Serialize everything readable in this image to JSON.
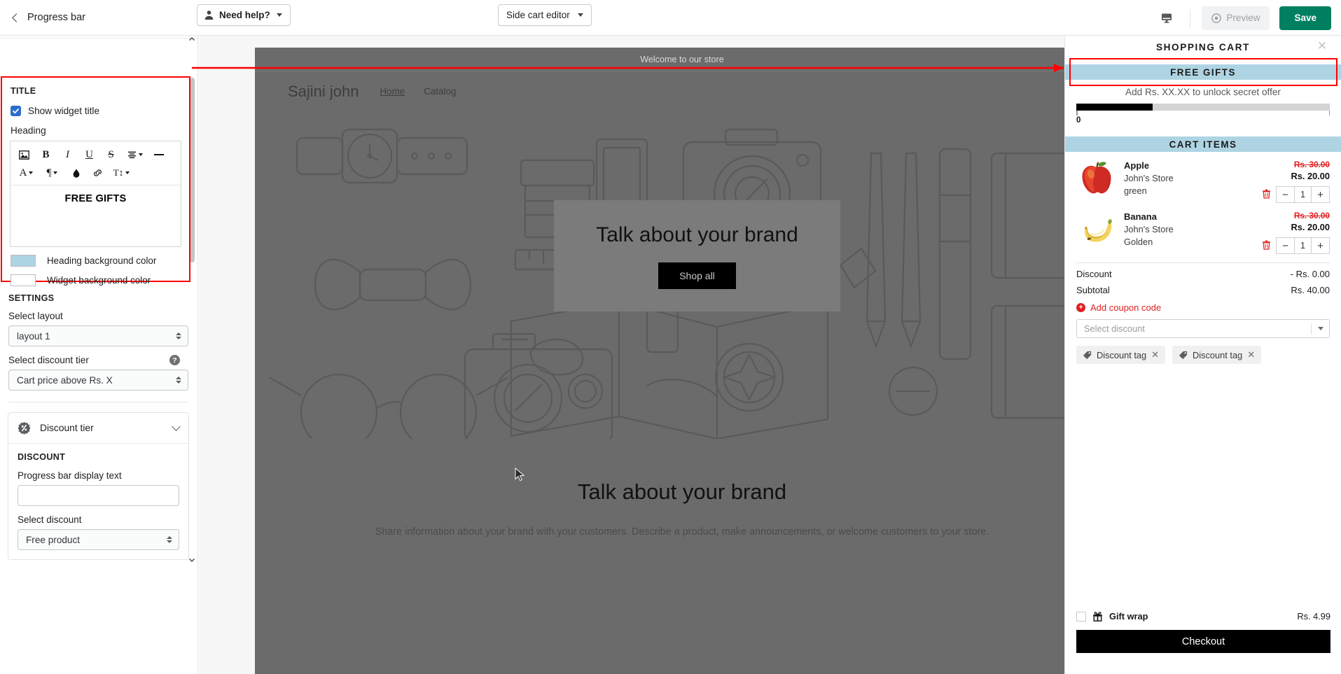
{
  "topbar": {
    "back_label": "Progress bar",
    "back_icon": "chevron-left-icon",
    "need_help_label": "Need help?",
    "need_help_icon": "person-icon",
    "side_cart_editor_label": "Side cart editor",
    "device_icon": "desktop-monitor-icon",
    "preview_label": "Preview",
    "preview_icon": "eye-icon",
    "save_label": "Save",
    "save_color": "#008060"
  },
  "left_panel": {
    "title_section": {
      "heading_label": "TITLE",
      "show_widget_title_label": "Show widget title",
      "show_widget_title_checked": true,
      "heading_field_label": "Heading",
      "editor_value": "FREE GIFTS",
      "toolbar_icons": [
        "image-icon",
        "bold-icon",
        "italic-icon",
        "underline-icon",
        "strikethrough-icon",
        "align-icon",
        "horizontal-rule-icon",
        "text-color-icon",
        "paragraph-icon",
        "highlight-icon",
        "link-icon",
        "line-height-icon"
      ],
      "heading_bg_label": "Heading background color",
      "heading_bg_color": "#aed4e3",
      "widget_bg_label": "Widget background color",
      "widget_bg_color": "#ffffff"
    },
    "settings_section": {
      "heading_label": "SETTINGS",
      "select_layout_label": "Select layout",
      "select_layout_value": "layout 1",
      "select_discount_tier_label": "Select discount tier",
      "select_discount_tier_value": "Cart price above Rs. X",
      "help_icon": "question-mark-icon"
    },
    "discount_tier_card": {
      "card_title": "Discount tier",
      "card_icon": "discount-percent-icon",
      "chevron_icon": "chevron-down-icon",
      "discount_label": "DISCOUNT",
      "progress_text_label": "Progress bar display text",
      "progress_text_value": "",
      "progress_text_placeholder": "",
      "select_discount_label": "Select discount",
      "select_discount_value": "Free product"
    }
  },
  "preview": {
    "announcement": "Welcome to our store",
    "brand": "Sajini john",
    "nav": [
      {
        "label": "Home",
        "active": true
      },
      {
        "label": "Catalog",
        "active": false
      }
    ],
    "hero_title": "Talk about your brand",
    "hero_button": "Shop all",
    "lower_title": "Talk about your brand",
    "lower_text": "Share information about your brand with your customers. Describe a product, make announcements, or welcome customers to your store."
  },
  "cart": {
    "title": "SHOPPING CART",
    "close_icon": "close-icon",
    "free_gifts_banner": "FREE GIFTS",
    "unlock_text": "Add Rs. XX.XX to unlock secret offer",
    "progress_percent": 30,
    "progress_min_label": "0",
    "cart_items_banner": "CART ITEMS",
    "items": [
      {
        "name": "Apple",
        "vendor": "John's Store",
        "variant": "green",
        "price_old": "Rs. 30.00",
        "price_new": "Rs. 20.00",
        "quantity": "1",
        "thumb_icon": "apple-icon"
      },
      {
        "name": "Banana",
        "vendor": "John's Store",
        "variant": "Golden",
        "price_old": "Rs. 30.00",
        "price_new": "Rs. 20.00",
        "quantity": "1",
        "thumb_icon": "banana-icon"
      }
    ],
    "discount_label": "Discount",
    "discount_value": "- Rs. 0.00",
    "subtotal_label": "Subtotal",
    "subtotal_value": "Rs. 40.00",
    "add_coupon_label": "Add coupon code",
    "select_discount_placeholder": "Select discount",
    "tags": [
      {
        "label": "Discount tag"
      },
      {
        "label": "Discount tag"
      }
    ],
    "gift_wrap_label": "Gift wrap",
    "gift_wrap_price": "Rs. 4.99",
    "gift_wrap_checked": false,
    "checkout_label": "Checkout",
    "banner_color": "#aed4e3",
    "accent_red": "#e02020"
  }
}
